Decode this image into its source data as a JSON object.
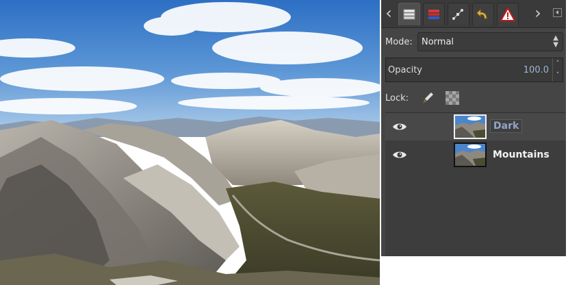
{
  "canvas": {
    "image_description_icon": "mountain-photo"
  },
  "dock": {
    "tabs": [
      {
        "icon": "layers-icon",
        "active": true
      },
      {
        "icon": "channels-icon",
        "active": false
      },
      {
        "icon": "paths-icon",
        "active": false
      },
      {
        "icon": "undo-history-icon",
        "active": false
      },
      {
        "icon": "error-console-icon",
        "active": false
      }
    ],
    "mode_label": "Mode:",
    "mode_value": "Normal",
    "opacity_label": "Opacity",
    "opacity_value": "100.0",
    "lock_label": "Lock:",
    "layers": [
      {
        "name": "Dark",
        "visible": true,
        "active": true,
        "editing": true
      },
      {
        "name": "Mountains",
        "visible": true,
        "active": false,
        "editing": false
      }
    ]
  }
}
